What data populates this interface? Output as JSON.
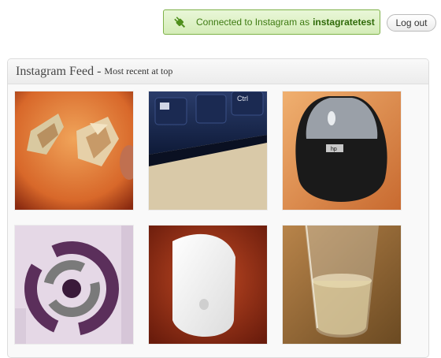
{
  "connection": {
    "prefix": "Connected to Instagram as",
    "username": "instagratetest",
    "icon": "plug-icon"
  },
  "logout_label": "Log out",
  "feed": {
    "title": "Instagram Feed",
    "separator": "-",
    "subtitle": "Most recent at top",
    "photos": [
      {
        "name": "photo-candy-wrappers"
      },
      {
        "name": "photo-keyboard-keys"
      },
      {
        "name": "photo-hp-mouse"
      },
      {
        "name": "photo-logo-print"
      },
      {
        "name": "photo-white-mouse"
      },
      {
        "name": "photo-glass-water"
      }
    ]
  },
  "photo_text": {
    "keyboard_key": "Ctrl",
    "mouse_brand": "hp"
  },
  "colors": {
    "notice_border": "#7fb24a",
    "notice_text": "#3d7a10"
  }
}
